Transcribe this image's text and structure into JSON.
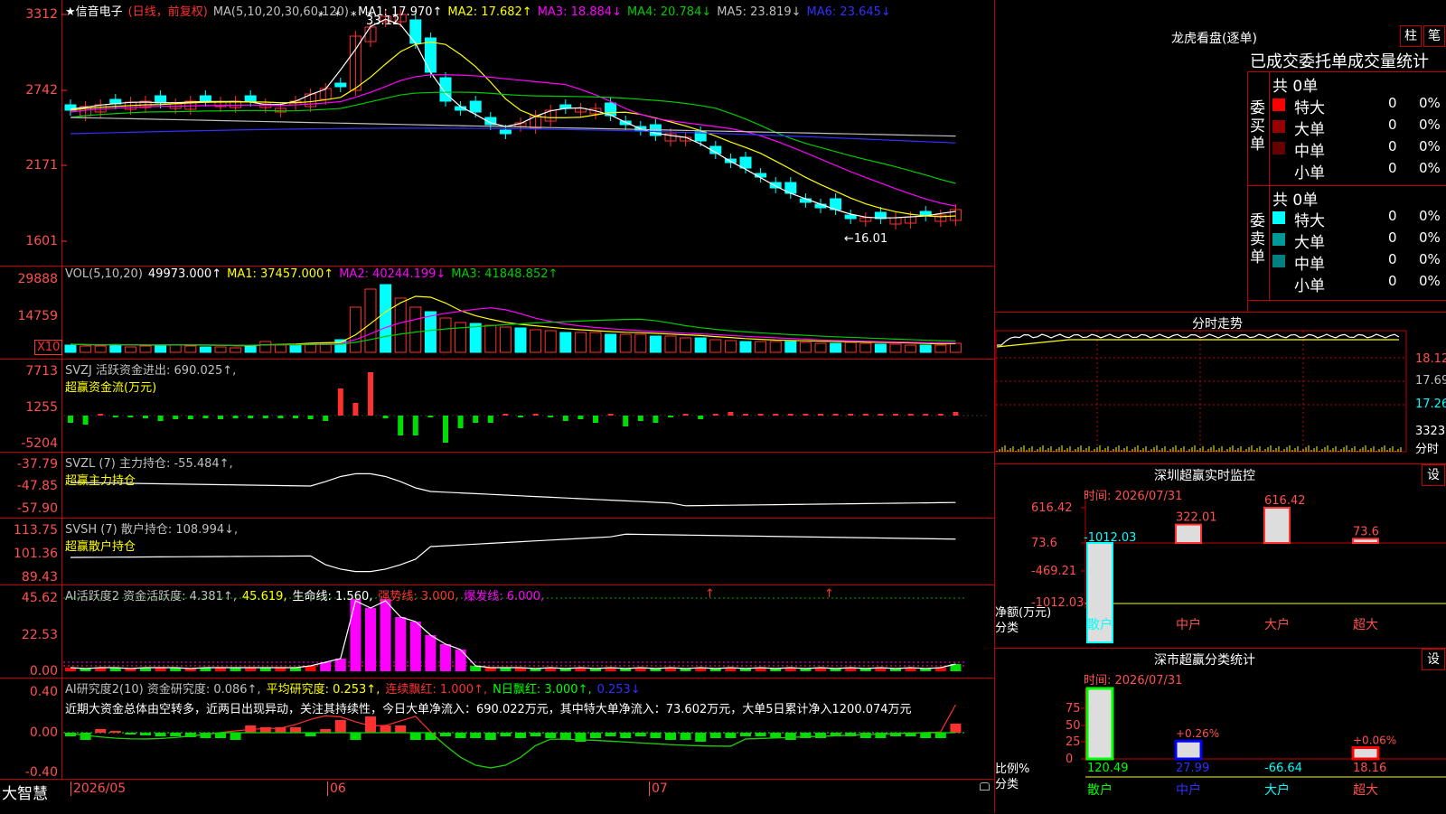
{
  "colors": {
    "up": "#ff3030",
    "down": "#00ffff",
    "frame": "#c00000",
    "ma1": "#ffffff",
    "ma2": "#ffff00",
    "ma3": "#ff00ff",
    "ma4": "#00cc00",
    "ma5": "#c0c0c0",
    "ma6": "#3030ff"
  },
  "price_panel": {
    "title": "★信音电子",
    "mode": "(日线，前复权)",
    "ma_label": "MA(5,10,20,30,60,120)",
    "mas": [
      {
        "label": "MA1: 17.970↑",
        "color": "#ffffff"
      },
      {
        "label": "MA2: 17.682↑",
        "color": "#ffff00"
      },
      {
        "label": "MA3: 18.884↓",
        "color": "#ff00ff"
      },
      {
        "label": "MA4: 20.784↓",
        "color": "#00cc00"
      },
      {
        "label": "MA5: 23.819↓",
        "color": "#c0c0c0"
      },
      {
        "label": "MA6: 23.645↓",
        "color": "#3030ff"
      }
    ],
    "yticks": [
      "3312",
      "2742",
      "2171",
      "1601"
    ],
    "high_label": "33.12",
    "low_label": "←16.01"
  },
  "vol_panel": {
    "title": "VOL(5,10,20)",
    "value": "49973.000↑",
    "mas": [
      {
        "label": "MA1: 37457.000↑",
        "color": "#ffff00"
      },
      {
        "label": "MA2: 40244.199↓",
        "color": "#ff00ff"
      },
      {
        "label": "MA3: 41848.852↑",
        "color": "#00cc00"
      }
    ],
    "yticks": [
      "29888",
      "14759"
    ],
    "unit": "X10"
  },
  "svzj_panel": {
    "title": "SVZJ  活跃资金进出: 690.025↑,",
    "subtitle": "超赢资金流(万元)",
    "yticks": [
      "7713",
      "1255",
      "-5204"
    ]
  },
  "svzl_panel": {
    "title": "SVZL (7) 主力持仓: -55.484↑,",
    "subtitle": "超赢主力持仓",
    "yticks": [
      "-37.79",
      "-47.85",
      "-57.90"
    ]
  },
  "svsh_panel": {
    "title": "SVSH (7) 散户持仓: 108.994↓,",
    "subtitle": "超赢散户持仓",
    "yticks": [
      "113.75",
      "101.36",
      "89.43"
    ]
  },
  "ai_active_panel": {
    "title": "AI活跃度2 资金活跃度: 4.381↑,",
    "items": [
      {
        "label": "45.619,",
        "color": "#ffff00"
      },
      {
        "label": "生命线: 1.560,",
        "color": "#ffffff"
      },
      {
        "label": "强势线: 3.000,",
        "color": "#ff3030"
      },
      {
        "label": "爆发线: 6.000,",
        "color": "#ff00ff"
      }
    ],
    "yticks": [
      "45.62",
      "22.53",
      "0.00"
    ]
  },
  "ai_research_panel": {
    "title": "AI研究度2(10) 资金研究度: 0.086↑,",
    "items": [
      {
        "label": "平均研究度: 0.253↑,",
        "color": "#ffff00"
      },
      {
        "label": "连续飘红: 1.000↑,",
        "color": "#ff3030"
      },
      {
        "label": "N日飘红: 3.000↑,",
        "color": "#00ff00"
      },
      {
        "label": "0.253↓",
        "color": "#3030ff"
      }
    ],
    "summary": "近期大资金总体由空转多，近两日出现异动，关注其持续性，今日大单净流入：690.022万元，其中特大单净流入：73.602万元，大单5日累计净入1200.074万元",
    "yticks": [
      "0.40",
      "0.00",
      "-0.40"
    ]
  },
  "bottom_axis": {
    "brand": "大智慧",
    "dates": [
      "2026/05",
      "06",
      "07"
    ]
  },
  "dragon_tiger": {
    "title": "龙虎看盘(逐单)",
    "btn_bar": "柱",
    "btn_stroke": "笔",
    "header": "已成交委托单成交量统计",
    "buy": {
      "label": "委买单",
      "count": "共 0单",
      "rows": [
        {
          "name": "特大",
          "val": "0",
          "pct": "0%",
          "color": "#ff0000"
        },
        {
          "name": "大单",
          "val": "0",
          "pct": "0%",
          "color": "#990000"
        },
        {
          "name": "中单",
          "val": "0",
          "pct": "0%",
          "color": "#660000"
        },
        {
          "name": "小单",
          "val": "0",
          "pct": "0%",
          "color": ""
        }
      ]
    },
    "sell": {
      "label": "委卖单",
      "count": "共 0单",
      "rows": [
        {
          "name": "特大",
          "val": "0",
          "pct": "0%",
          "color": "#00ffff"
        },
        {
          "name": "大单",
          "val": "0",
          "pct": "0%",
          "color": "#009999"
        },
        {
          "name": "中单",
          "val": "0",
          "pct": "0%",
          "color": "#008080"
        },
        {
          "name": "小单",
          "val": "0",
          "pct": "0%",
          "color": ""
        }
      ]
    }
  },
  "intraday": {
    "title": "分时走势",
    "yticks": [
      "18.12",
      "17.69",
      "17.26"
    ],
    "vol_label": "3323",
    "footer": "分时"
  },
  "sz_monitor": {
    "title": "深圳超赢实时监控",
    "time": "时间: 2026/07/31",
    "set": "设",
    "yticks": [
      "616.42",
      "73.6",
      "-469.21",
      "-1012.03"
    ],
    "ylabel": "净额(万元)",
    "xlabel": "分类",
    "values": [
      {
        "cat": "散户",
        "value": "-1012.03",
        "num": -1012.03
      },
      {
        "cat": "中户",
        "value": "322.01",
        "num": 322.01
      },
      {
        "cat": "大户",
        "value": "616.42",
        "num": 616.42
      },
      {
        "cat": "超大",
        "value": "73.6",
        "num": 73.6
      }
    ]
  },
  "sz_category": {
    "title": "深市超赢分类统计",
    "time": "时间: 2026/07/31",
    "set": "设",
    "yticks": [
      "75",
      "50",
      "25",
      "0"
    ],
    "ylabel": "比例%",
    "xlabel": "分类",
    "bars": [
      {
        "cat": "散户",
        "value": "120.49",
        "label": "",
        "num": 75
      },
      {
        "cat": "中户",
        "value": "27.99",
        "label": "+0.26%",
        "num": 19
      },
      {
        "cat": "大户",
        "value": "-66.64",
        "label": "",
        "num": 0
      },
      {
        "cat": "超大",
        "value": "18.16",
        "label": "+0.06%",
        "num": 12
      }
    ]
  }
}
